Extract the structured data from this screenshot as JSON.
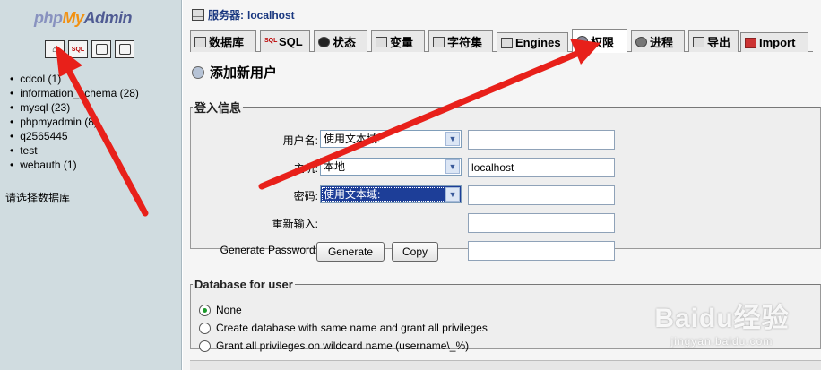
{
  "nav": {
    "logo": {
      "php": "php",
      "my": "My",
      "admin": "Admin"
    },
    "icons": [
      "home-icon",
      "sql-query-icon",
      "docs-icon",
      "docs-icon"
    ],
    "sql_icon_text": "SQL",
    "databases": [
      "cdcol (1)",
      "information_schema (28)",
      "mysql (23)",
      "phpmyadmin (8)",
      "q2565445",
      "test",
      "webauth (1)"
    ],
    "choose_db": "请选择数据库"
  },
  "server": {
    "label": "服务器:",
    "name": "localhost"
  },
  "tabs": [
    {
      "label": "数据库",
      "icon": "database-icon"
    },
    {
      "label": "SQL",
      "icon": "sql-icon",
      "icon_text": "SQL"
    },
    {
      "label": "状态",
      "icon": "status-icon"
    },
    {
      "label": "变量",
      "icon": "variables-icon"
    },
    {
      "label": "字符集",
      "icon": "charset-icon"
    },
    {
      "label": "Engines",
      "icon": "engines-icon"
    },
    {
      "label": "权限",
      "icon": "privileges-icon",
      "active": true
    },
    {
      "label": "进程",
      "icon": "process-icon"
    },
    {
      "label": "导出",
      "icon": "export-icon"
    },
    {
      "label": "Import",
      "icon": "import-icon"
    }
  ],
  "page_title": "添加新用户",
  "login_info": {
    "legend": "登入信息",
    "username": {
      "label": "用户名:",
      "select": "使用文本域:",
      "value": ""
    },
    "host": {
      "label": "主机:",
      "select": "本地",
      "value": "localhost"
    },
    "password": {
      "label": "密码:",
      "select": "使用文本域:",
      "value": ""
    },
    "retype": {
      "label": "重新输入:",
      "value": ""
    },
    "generate": {
      "label": "Generate Password:",
      "generate_btn": "Generate",
      "copy_btn": "Copy",
      "value": ""
    }
  },
  "db_for_user": {
    "legend": "Database for user",
    "options": [
      {
        "label": "None",
        "checked": true
      },
      {
        "label": "Create database with same name and grant all privileges",
        "checked": false
      },
      {
        "label": "Grant all privileges on wildcard name (username\\_%)",
        "checked": false
      }
    ]
  },
  "watermark": {
    "brand": "Baidu经验",
    "site": "jingyan.baidu.com"
  },
  "colors": {
    "annotation_arrow": "#e8201a",
    "selected_option": "#1d3e98",
    "link_blue": "#1a3880"
  }
}
